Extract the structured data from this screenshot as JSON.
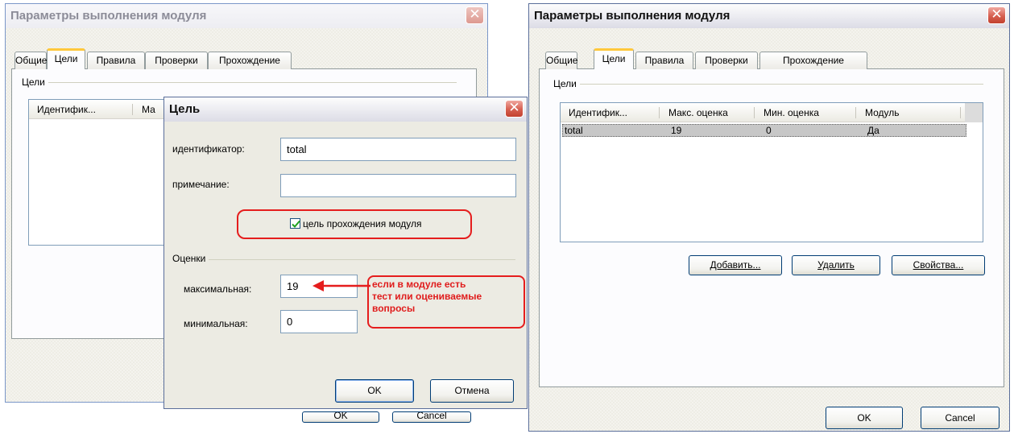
{
  "back_window": {
    "title": "Параметры выполнения модуля",
    "tabs": [
      "Общие",
      "Цели",
      "Правила",
      "Проверки",
      "Прохождение"
    ],
    "selected_tab": "Цели",
    "group_label": "Цели",
    "columns": [
      "Идентифик...",
      "Ма"
    ]
  },
  "goal_dialog": {
    "title": "Цель",
    "id_label": "идентификатор:",
    "id_value": "total",
    "note_label": "примечание:",
    "note_value": "",
    "checkbox_label": "цель прохождения модуля",
    "checkbox_checked": true,
    "scores_group_label": "Оценки",
    "max_label": "максимальная:",
    "max_value": "19",
    "min_label": "минимальная:",
    "min_value": "0",
    "ok_label": "OK",
    "cancel_label": "Отмена"
  },
  "annotation": {
    "text_line1": "если в модуле есть",
    "text_line2": "тест или оцениваемые",
    "text_line3": "вопросы",
    "color": "#e01c1c"
  },
  "main_window": {
    "title": "Параметры выполнения модуля",
    "tabs": [
      "Общие",
      "Цели",
      "Правила",
      "Проверки",
      "Прохождение"
    ],
    "selected_tab": "Цели",
    "group_label": "Цели",
    "columns": [
      "Идентифик...",
      "Макс. оценка",
      "Мин. оценка",
      "Модуль"
    ],
    "rows": [
      {
        "id": "total",
        "max": "19",
        "min": "0",
        "module": "Да"
      }
    ],
    "add_button": "Добавить...",
    "delete_button": "Удалить",
    "props_button": "Свойства...",
    "ok_label": "OK",
    "cancel_label": "Cancel"
  }
}
